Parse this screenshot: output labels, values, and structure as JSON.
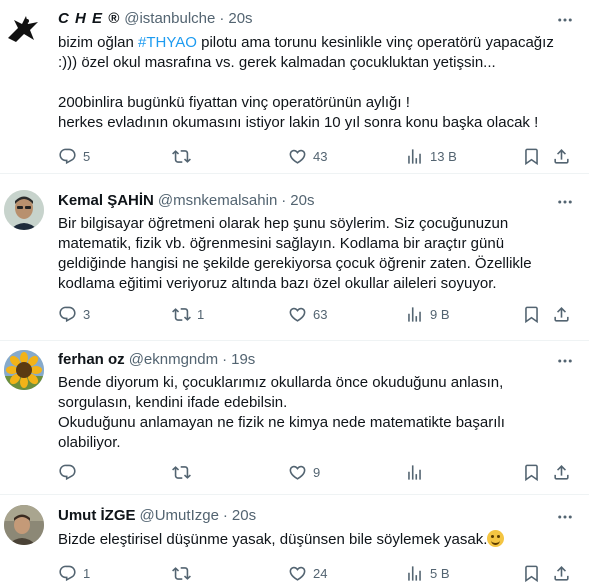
{
  "tweets": [
    {
      "name": "C H E ®",
      "handle": "@istanbulche",
      "time": "20s",
      "text_before": "bizim oğlan ",
      "hashtag": "#THYAO",
      "text_after": " pilotu ama torunu kesinlikle vinç operatörü yapacağız",
      "line2": ":))) özel okul masrafına vs. gerek kalmadan çocukluktan yetişsin...",
      "line4": "200binlira bugünkü fiyattan vinç operatörünün aylığı !",
      "line5": "herkes evladının okumasını istiyor lakin 10 yıl sonra konu başka olacak !",
      "replies": "5",
      "reposts": "",
      "likes": "43",
      "views": "13 B"
    },
    {
      "name": "Kemal ŞAHİN",
      "handle": "@msnkemalsahin",
      "time": "20s",
      "lines": [
        "Bir bilgisayar öğretmeni olarak hep şunu söylerim. Siz çocuğunuzun",
        "matematik, fizik vb. öğrenmesini sağlayın. Kodlama bir araçtır günü",
        "geldiğinde hangisi ne şekilde gerekiyorsa çocuk öğrenir zaten. Özellikle",
        "kodlama eğitimi veriyoruz altında bazı özel okullar aileleri soyuyor."
      ],
      "replies": "3",
      "reposts": "1",
      "likes": "63",
      "views": "9 B"
    },
    {
      "name": "ferhan oz",
      "handle": "@eknmgndm",
      "time": "19s",
      "lines": [
        "Bende diyorum ki, çocuklarımız okullarda önce okuduğunu anlasın,",
        "sorgulasın, kendini ifade edebilsin.",
        "Okuduğunu anlamayan ne fizik ne kimya nede matematikte başarılı",
        "olabiliyor."
      ],
      "replies": "",
      "reposts": "",
      "likes": "9",
      "views": ""
    },
    {
      "name": "Umut İZGE",
      "handle": "@UmutIzge",
      "time": "20s",
      "line1": "Bizde eleştirisel düşünme yasak, düşünsen bile söylemek yasak.",
      "replies": "1",
      "reposts": "",
      "likes": "24",
      "views": "5 B"
    }
  ],
  "icons": {
    "more": "more-icon",
    "reply": "reply-icon",
    "repost": "repost-icon",
    "like": "like-icon",
    "views": "views-icon",
    "bookmark": "bookmark-icon",
    "share": "share-icon"
  },
  "colors": {
    "hashtag": "#1d9bf0",
    "secondary": "#536471",
    "text": "#0f1419"
  }
}
